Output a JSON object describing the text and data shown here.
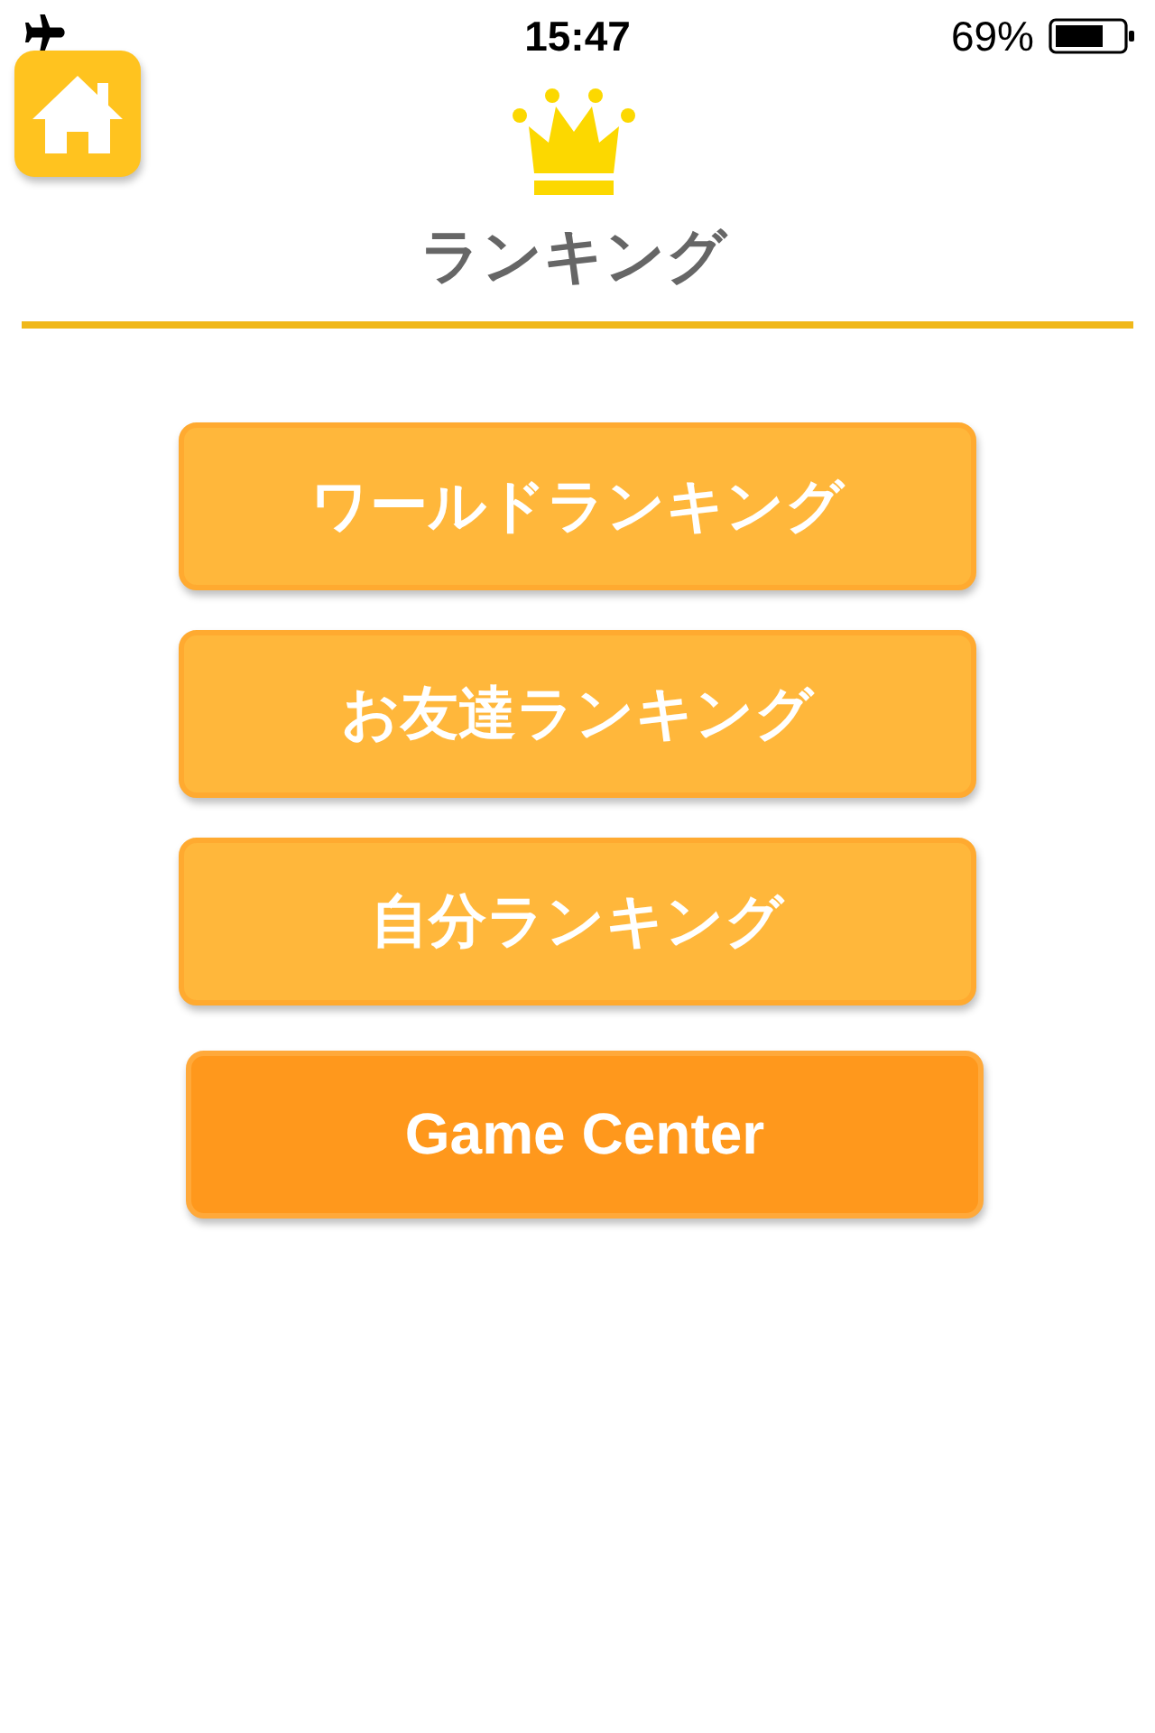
{
  "status_bar": {
    "time": "15:47",
    "battery": "69%"
  },
  "header": {
    "title": "ランキング"
  },
  "buttons": [
    {
      "label": "ワールドランキング",
      "kind": "ranking"
    },
    {
      "label": "お友達ランキング",
      "kind": "ranking"
    },
    {
      "label": "自分ランキング",
      "kind": "ranking"
    },
    {
      "label": "Game Center",
      "kind": "gamecenter"
    }
  ]
}
